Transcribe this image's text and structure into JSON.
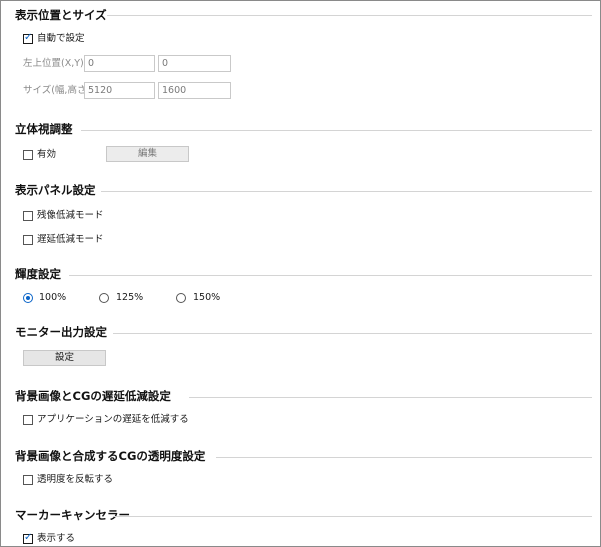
{
  "display_position_size": {
    "title": "表示位置とサイズ",
    "auto_setting": {
      "label": "自動で設定",
      "checked": true
    },
    "top_left": {
      "label": "左上位置(X,Y)",
      "x": "0",
      "y": "0"
    },
    "size": {
      "label": "サイズ(幅,高さ)",
      "width": "5120",
      "height": "1600"
    }
  },
  "stereo_adjust": {
    "title": "立体視調整",
    "enabled": {
      "label": "有効",
      "checked": false
    },
    "edit_button": "編集"
  },
  "display_panel": {
    "title": "表示パネル設定",
    "afterimage": {
      "label": "残像低減モード",
      "checked": false
    },
    "latency": {
      "label": "遅延低減モード",
      "checked": false
    }
  },
  "brightness": {
    "title": "輝度設定",
    "options": [
      "100%",
      "125%",
      "150%"
    ],
    "selected": "100%"
  },
  "monitor_output": {
    "title": "モニター出力設定",
    "settings_button": "設定"
  },
  "bg_cg_latency": {
    "title": "背景画像とCGの遅延低減設定",
    "reduce_app_latency": {
      "label": "アプリケーションの遅延を低減する",
      "checked": false
    }
  },
  "bg_cg_transparency": {
    "title": "背景画像と合成するCGの透明度設定",
    "invert": {
      "label": "透明度を反転する",
      "checked": false
    }
  },
  "marker_canceller": {
    "title": "マーカーキャンセラー",
    "show": {
      "label": "表示する",
      "checked": true
    }
  },
  "colors": {
    "accent": "#0a64c8",
    "rule": "#d4d4d4",
    "disabled_text": "#8a8a8a"
  }
}
